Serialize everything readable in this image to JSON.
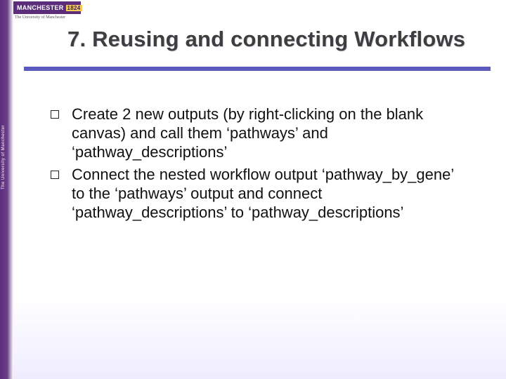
{
  "logo": {
    "name": "MANCHESTER",
    "year": "1824",
    "subline": "The University of Manchester"
  },
  "sidebar_text": "The University of Manchester",
  "title": "7. Reusing and connecting Workflows",
  "bullets": [
    "Create 2 new outputs (by right-clicking on the blank canvas) and call them ‘pathways’ and ‘pathway_descriptions’",
    "Connect the nested workflow output ‘pathway_by_gene’ to the ‘pathways’ output and connect ‘pathway_descriptions’ to ‘pathway_descriptions’"
  ]
}
